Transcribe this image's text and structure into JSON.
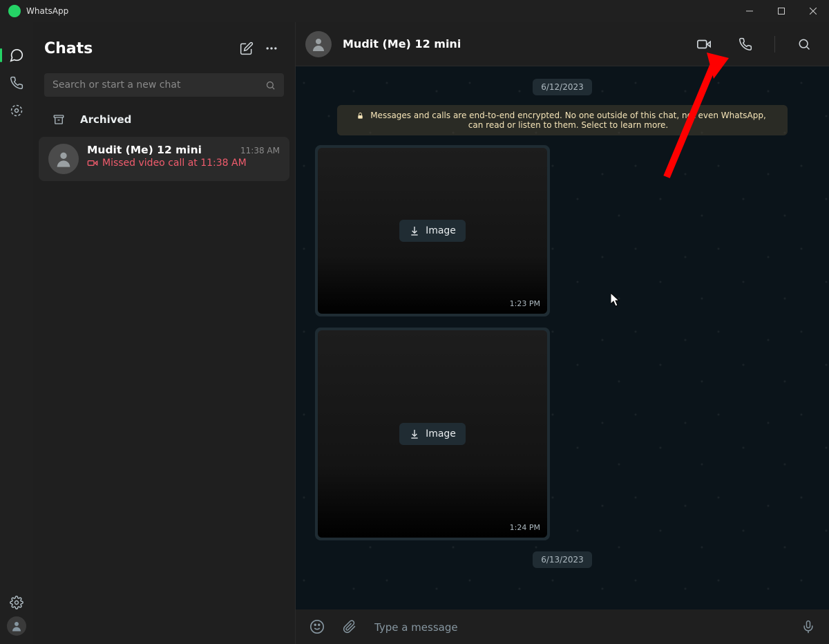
{
  "title": "WhatsApp",
  "panel": {
    "heading": "Chats",
    "search_placeholder": "Search or start a new chat",
    "archived_label": "Archived"
  },
  "chat_list": [
    {
      "name": "Mudit (Me) 12 mini",
      "time": "11:38 AM",
      "subtitle": "Missed video call at 11:38 AM"
    }
  ],
  "conversation": {
    "contact_name": "Mudit (Me) 12 mini",
    "date_pill_1": "6/12/2023",
    "encryption_notice": "Messages and calls are end-to-end encrypted. No one outside of this chat, not even WhatsApp, can read or listen to them. Select to learn more.",
    "messages": [
      {
        "type": "image",
        "download_label": "Image",
        "time": "1:23 PM"
      },
      {
        "type": "image",
        "download_label": "Image",
        "time": "1:24 PM"
      }
    ],
    "date_pill_2": "6/13/2023",
    "compose_placeholder": "Type a message"
  }
}
